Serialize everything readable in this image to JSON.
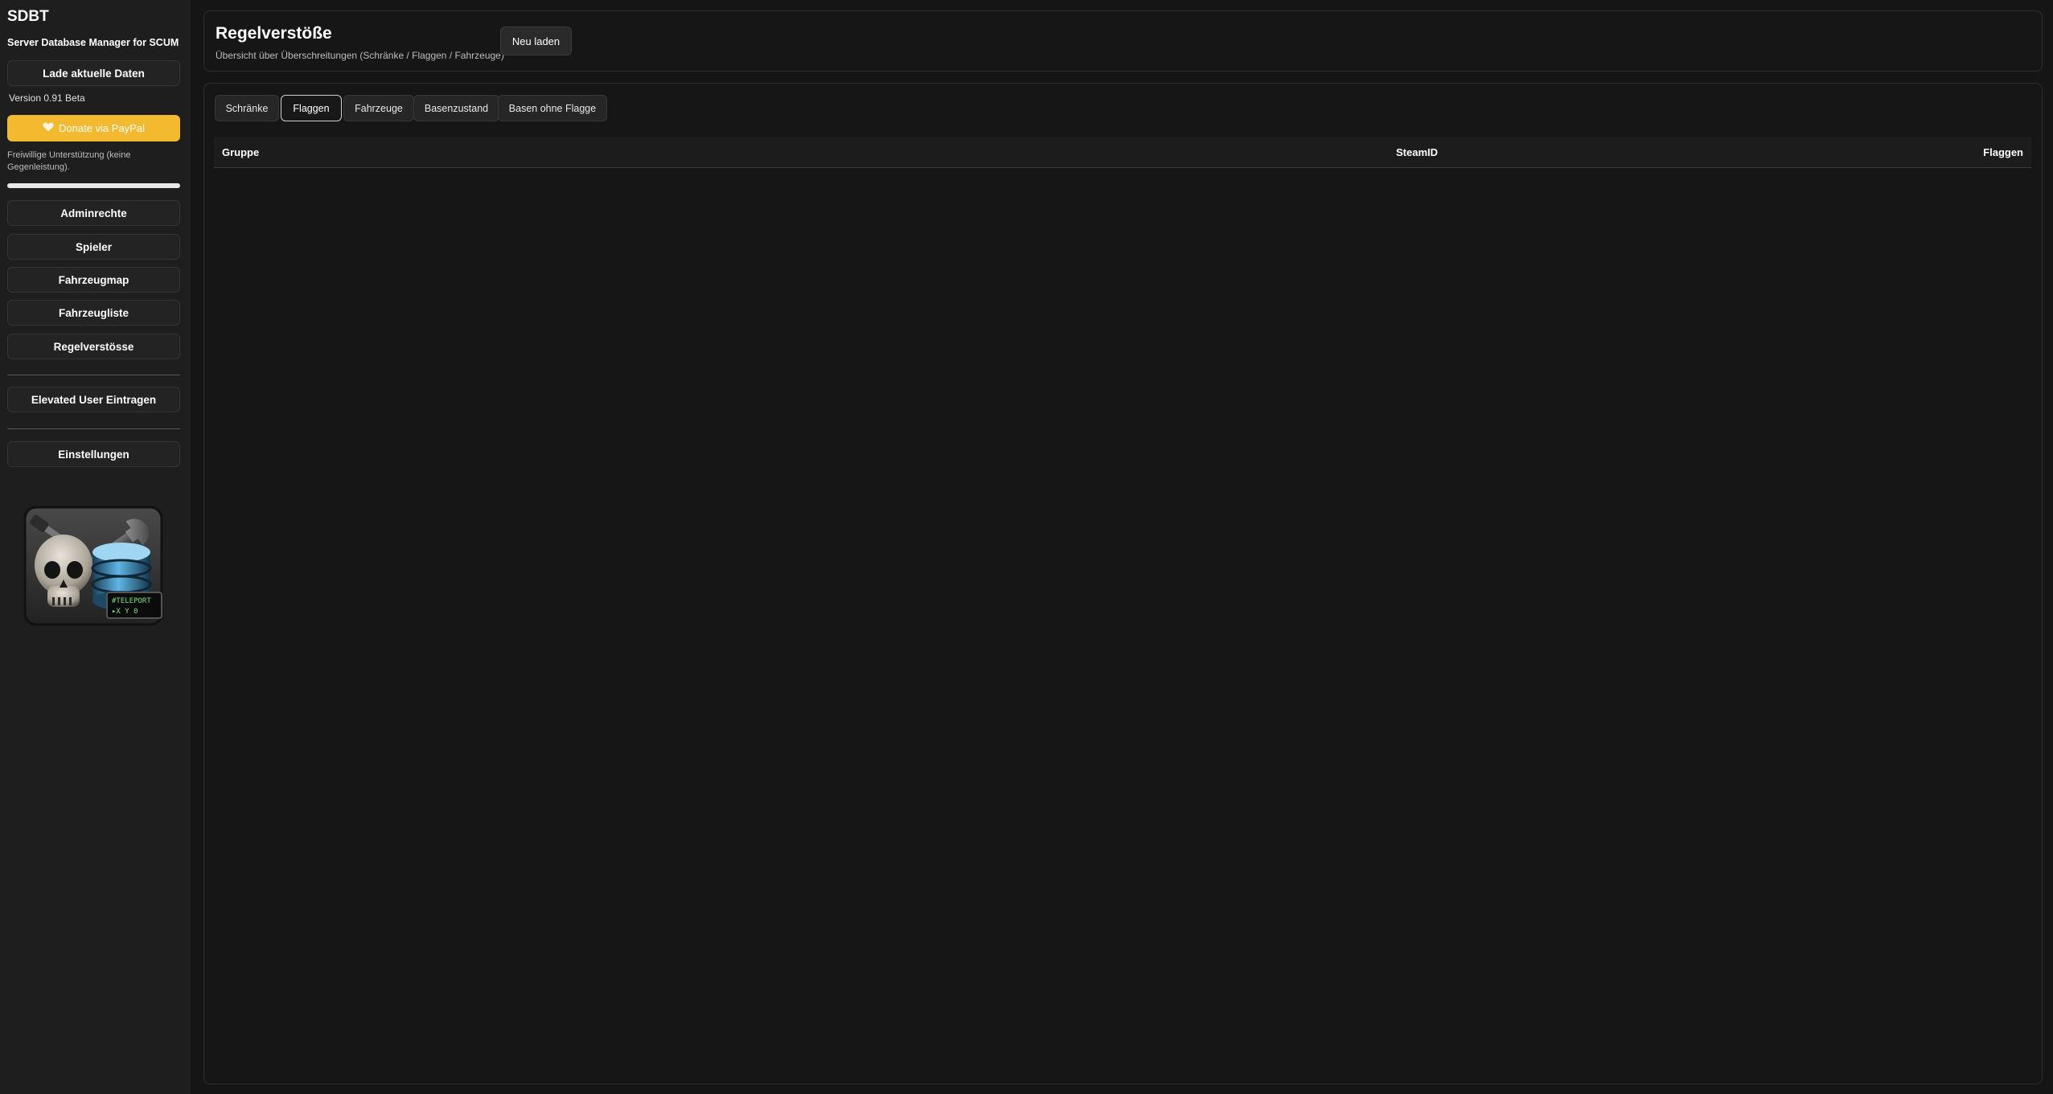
{
  "sidebar": {
    "app_title": "SDBT",
    "app_subtitle": "Server Database Manager for SCUM",
    "load_button": "Lade aktuelle Daten",
    "version": "Version 0.91 Beta",
    "donate_button": "Donate via PayPal",
    "donate_note": "Freiwillige Unterstützung (keine Gegenleistung).",
    "load_progress": 1.0,
    "nav": [
      "Adminrechte",
      "Spieler",
      "Fahrzeugmap",
      "Fahrzeugliste",
      "Regelverstösse"
    ],
    "elevated_button": "Elevated User Eintragen",
    "settings_button": "Einstellungen",
    "logo_text": "#TELEPORT X Y 0",
    "donate_color": "#f3ba2f"
  },
  "header": {
    "title": "Regelverstöße",
    "subtitle": "Übersicht über Überschreitungen (Schränke / Flaggen / Fahrzeuge)",
    "reload_button": "Neu laden"
  },
  "tabs": [
    "Schränke",
    "Flaggen",
    "Fahrzeuge",
    "Basenzustand",
    "Basen ohne Flagge"
  ],
  "active_tab": "Flaggen",
  "table": {
    "columns": [
      "Gruppe",
      "SteamID",
      "Flaggen"
    ],
    "rows": []
  }
}
